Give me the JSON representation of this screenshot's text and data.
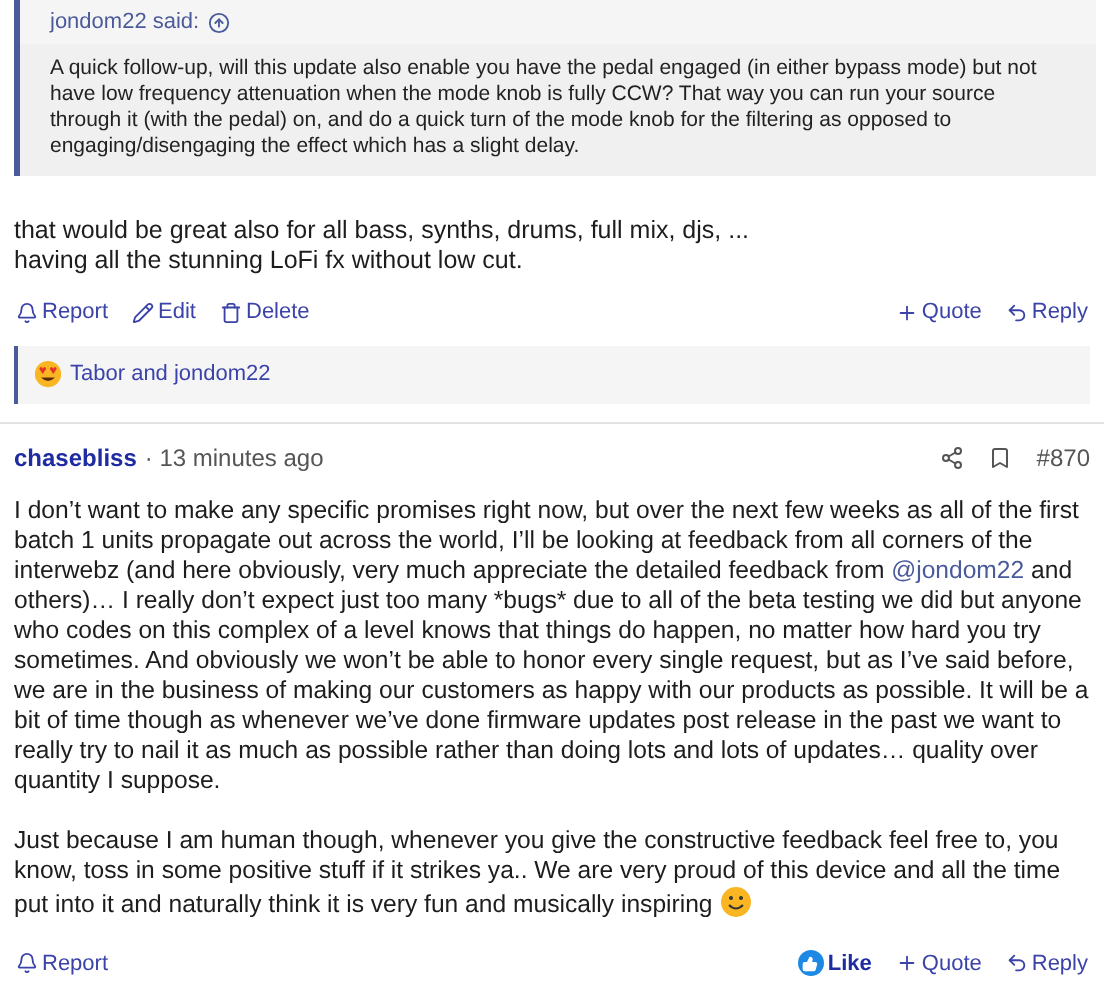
{
  "quote": {
    "author": "jondom22 said:",
    "text": "A quick follow-up, will this update also enable you have the pedal engaged (in either bypass mode) but not have low frequency attenuation when the mode knob is fully CCW? That way you can run your source through it (with the pedal) on, and do a quick turn of the mode knob for the filtering as opposed to engaging/disengaging the effect which has a slight delay."
  },
  "reply_lines": [
    "that would be great also for all bass, synths, drums, full mix, djs, ...",
    "having all the stunning LoFi fx without low cut."
  ],
  "post_actions": [
    {
      "kind": "report",
      "label": "Report"
    },
    {
      "kind": "edit",
      "label": "Edit"
    },
    {
      "kind": "delete",
      "label": "Delete"
    }
  ],
  "post_actions_right": [
    {
      "kind": "quote",
      "label": "Quote"
    },
    {
      "kind": "reply",
      "label": "Reply"
    }
  ],
  "reactions": {
    "text": "Tabor and jondom22"
  },
  "next_post": {
    "author": "chasebliss",
    "time": "· 13 minutes ago",
    "number": "#870",
    "paragraph_1_before": "I don’t want to make any specific promises right now, but over the next few weeks as all of the first batch 1 units propagate out across the world, I’ll be looking at feedback from all corners of the interwebz (and here obviously, very much appreciate the detailed feedback from",
    "mention": "@jondom22",
    "paragraph_1_after": "and others)… I really don’t expect just too many *bugs* due to all of the beta testing we did but anyone who codes on this complex of a level knows that things do happen, no matter how hard you try sometimes. And obviously we won’t be able to honor every single request, but as I’ve said before, we are in the business of making our customers as happy with our products as possible. It will be a bit of time though as whenever we’ve done firmware updates post release in the past we want to really try to nail it as much as possible rather than doing lots and lots of updates… quality over quantity I suppose.",
    "paragraph_2": "Just because I am human though, whenever you give the constructive feedback feel free to, you know, toss in some positive stuff if it strikes ya.. We are very proud of this device and all the time put into it and naturally think it is very fun and musically inspiring",
    "actions_left": [
      {
        "kind": "report",
        "label": "Report"
      }
    ],
    "actions_right": [
      {
        "kind": "like",
        "label": "Like"
      },
      {
        "kind": "quote",
        "label": "Quote"
      },
      {
        "kind": "reply",
        "label": "Reply"
      }
    ]
  }
}
